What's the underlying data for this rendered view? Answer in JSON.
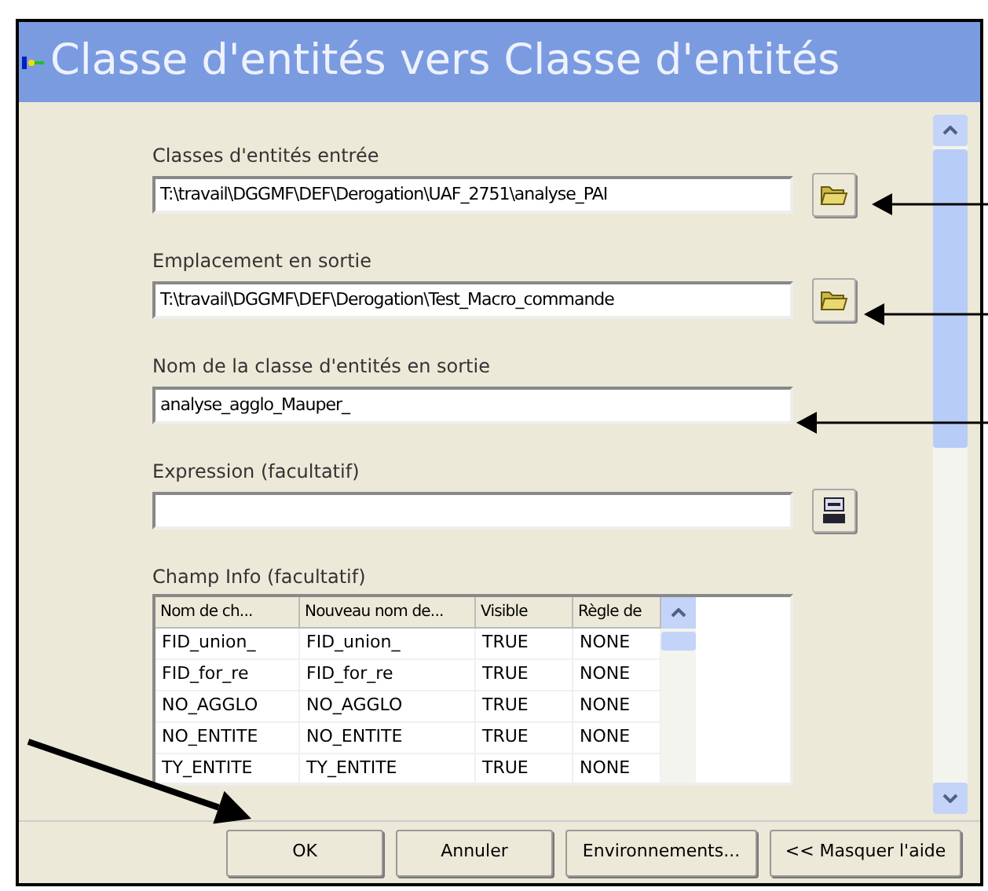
{
  "window": {
    "title": "Classe d'entités vers Classe d'entités"
  },
  "fields": [
    {
      "kind": "path",
      "label": "Classes d'entités entrée",
      "value": "T:\\travail\\DGGMF\\DEF\\Derogation\\UAF_2751\\analyse_PAI"
    },
    {
      "kind": "path",
      "label": "Emplacement en sortie",
      "value": "T:\\travail\\DGGMF\\DEF\\Derogation\\Test_Macro_commande"
    },
    {
      "kind": "text",
      "label": "Nom de la classe d'entités en sortie",
      "value": "analyse_agglo_Mauper_"
    },
    {
      "kind": "sql",
      "label": "Expression (facultatif)"
    }
  ],
  "table": {
    "label": "Champ Info (facultatif)",
    "columns": [
      "Nom de ch...",
      "Nouveau nom de...",
      "Visible",
      "Règle de"
    ],
    "rows": [
      [
        "FID_union_",
        "FID_union_",
        "TRUE",
        "NONE"
      ],
      [
        "FID_for_re",
        "FID_for_re",
        "TRUE",
        "NONE"
      ],
      [
        "NO_AGGLO",
        "NO_AGGLO",
        "TRUE",
        "NONE"
      ],
      [
        "NO_ENTITE",
        "NO_ENTITE",
        "TRUE",
        "NONE"
      ],
      [
        "TY_ENTITE",
        "TY_ENTITE",
        "TRUE",
        "NONE"
      ]
    ]
  },
  "buttons": [
    "OK",
    "Annuler",
    "Environnements...",
    "<< Masquer l'aide"
  ]
}
